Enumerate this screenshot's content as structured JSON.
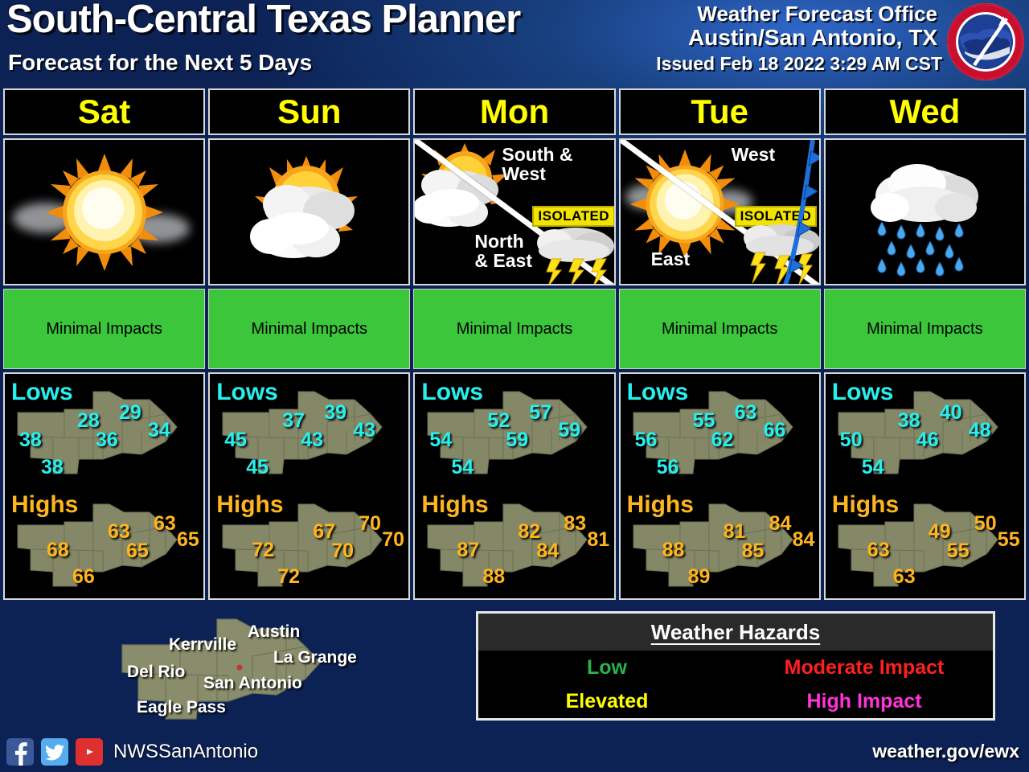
{
  "header": {
    "title": "South-Central Texas Planner",
    "subtitle": "Forecast for the Next 5 Days",
    "office_line1": "Weather Forecast Office",
    "office_line2": "Austin/San Antonio, TX",
    "issued": "Issued Feb 18 2022 3:29 AM CST",
    "logo_name": "National Weather Service"
  },
  "days": [
    {
      "name": "Sat",
      "icon": "sunny",
      "impact": "Minimal Impacts",
      "impact_color": "#3bc63b",
      "regions": [],
      "lows_label": "Lows",
      "highs_label": "Highs",
      "lows": [
        38,
        28,
        29,
        36,
        34,
        38
      ],
      "highs": [
        68,
        63,
        63,
        65,
        65,
        66
      ]
    },
    {
      "name": "Sun",
      "icon": "partly-cloudy",
      "impact": "Minimal Impacts",
      "impact_color": "#3bc63b",
      "regions": [],
      "lows_label": "Lows",
      "highs_label": "Highs",
      "lows": [
        45,
        37,
        39,
        43,
        43,
        45
      ],
      "highs": [
        72,
        67,
        70,
        70,
        70,
        72
      ]
    },
    {
      "name": "Mon",
      "icon": "split-partlycloudy-isolatedstorms",
      "impact": "Minimal Impacts",
      "impact_color": "#3bc63b",
      "regions": [
        "South & West",
        "North & East"
      ],
      "badge": "ISOLATED",
      "lows_label": "Lows",
      "highs_label": "Highs",
      "lows": [
        54,
        52,
        57,
        59,
        59,
        54
      ],
      "highs": [
        87,
        82,
        83,
        84,
        81,
        88
      ]
    },
    {
      "name": "Tue",
      "icon": "split-sunny-isolatedstorms-front",
      "impact": "Minimal Impacts",
      "impact_color": "#3bc63b",
      "regions": [
        "West",
        "East"
      ],
      "badge": "ISOLATED",
      "lows_label": "Lows",
      "highs_label": "Highs",
      "lows": [
        56,
        55,
        63,
        62,
        66,
        56
      ],
      "highs": [
        88,
        81,
        84,
        85,
        84,
        89
      ]
    },
    {
      "name": "Wed",
      "icon": "rain",
      "impact": "Minimal Impacts",
      "impact_color": "#3bc63b",
      "regions": [],
      "lows_label": "Lows",
      "highs_label": "Highs",
      "lows": [
        50,
        38,
        40,
        46,
        48,
        54
      ],
      "highs": [
        63,
        49,
        50,
        55,
        55,
        63
      ]
    }
  ],
  "footer_map": {
    "cities": [
      "Kerrville",
      "Austin",
      "La Grange",
      "Del Rio",
      "San Antonio",
      "Eagle Pass"
    ]
  },
  "hazards": {
    "title": "Weather Hazards",
    "items": [
      {
        "label": "Low",
        "color": "#29b34e"
      },
      {
        "label": "Moderate Impact",
        "color": "#ff2020"
      },
      {
        "label": "Elevated",
        "color": "#ffff00"
      },
      {
        "label": "High Impact",
        "color": "#ff33d6"
      }
    ]
  },
  "social": {
    "handle": "NWSSanAntonio",
    "icons": [
      "facebook-icon",
      "twitter-icon",
      "youtube-icon"
    ]
  },
  "website": "weather.gov/ewx"
}
